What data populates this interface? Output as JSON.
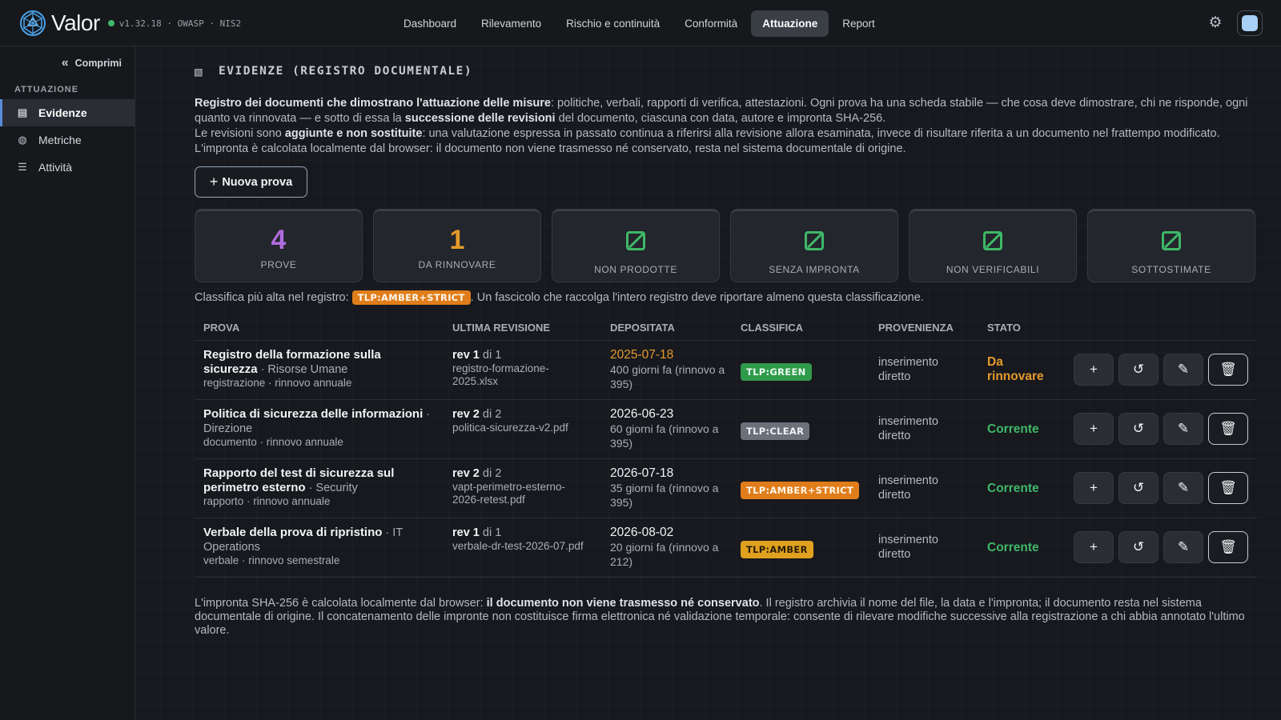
{
  "brand": {
    "name": "Valor",
    "version": "v1.32.18 · OWASP · NIS2",
    "accent": "#3fb868"
  },
  "nav": [
    {
      "label": "Dashboard",
      "active": false
    },
    {
      "label": "Rilevamento",
      "active": false
    },
    {
      "label": "Rischio e continuità",
      "active": false
    },
    {
      "label": "Conformità",
      "active": false
    },
    {
      "label": "Attuazione",
      "active": true
    },
    {
      "label": "Report",
      "active": false
    }
  ],
  "sidebar": {
    "collapse_label": "Comprimi",
    "section": "ATTUAZIONE",
    "items": [
      {
        "label": "Evidenze",
        "icon": "evidence-icon",
        "active": true
      },
      {
        "label": "Metriche",
        "icon": "metrics-icon",
        "active": false
      },
      {
        "label": "Attività",
        "icon": "list-icon",
        "active": false
      }
    ]
  },
  "page": {
    "title": "EVIDENZE (REGISTRO DOCUMENTALE)",
    "intro": {
      "p1_bold": "Registro dei documenti che dimostrano l'attuazione delle misure",
      "p1_a": ": politiche, verbali, rapporti di verifica, attestazioni. Ogni prova ha una scheda stabile — che cosa deve dimostrare, chi ne risponde, ogni quanto va rinnovata — e sotto di essa la ",
      "p1_bold2": "successione delle revisioni",
      "p1_b": " del documento, ciascuna con data, autore e impronta SHA-256.",
      "p2_a": "Le revisioni sono ",
      "p2_bold": "aggiunte e non sostituite",
      "p2_b": ": una valutazione espressa in passato continua a riferirsi alla revisione allora esaminata, invece di risultare riferita a un documento nel frattempo modificato. L'impronta è calcolata localmente dal browser: il documento non viene trasmesso né conservato, resta nel sistema documentale di origine."
    },
    "new_button": "Nuova prova"
  },
  "stats": [
    {
      "value": "4",
      "label": "PROVE",
      "color": "#b06ce0"
    },
    {
      "value": "1",
      "label": "DA RINNOVARE",
      "color": "#e59a2b"
    },
    {
      "value": "0",
      "label": "NON PRODOTTE",
      "color": "#3fb868"
    },
    {
      "value": "0",
      "label": "SENZA IMPRONTA",
      "color": "#3fb868"
    },
    {
      "value": "0",
      "label": "NON VERIFICABILI",
      "color": "#3fb868"
    },
    {
      "value": "0",
      "label": "SOTTOSTIMATE",
      "color": "#3fb868"
    }
  ],
  "classification": {
    "prefix": "Classifica più alta nel registro:",
    "badge": "TLP:AMBER+STRICT",
    "suffix": ". Un fascicolo che raccolga l'intero registro deve riportare almeno questa classificazione."
  },
  "table": {
    "headers": [
      "PROVA",
      "ULTIMA REVISIONE",
      "DEPOSITATA",
      "CLASSIFICA",
      "PROVENIENZA",
      "STATO"
    ],
    "rows": [
      {
        "title": "Registro della formazione sulla sicurezza",
        "owner": " · Risorse Umane",
        "meta": "registrazione · rinnovo annuale",
        "rev": "rev 1",
        "rev_of": " di 1",
        "file": "registro-formazione-2025.xlsx",
        "date": "2025-07-18",
        "ago": "400 giorni fa (rinnovo a 395)",
        "tlp": "TLP:GREEN",
        "origin": "inserimento diretto",
        "status": "Da rinnovare"
      },
      {
        "title": "Politica di sicurezza delle informazioni",
        "owner": " · Direzione",
        "meta": "documento · rinnovo annuale",
        "rev": "rev 2",
        "rev_of": " di 2",
        "file": "politica-sicurezza-v2.pdf",
        "date": "2026-06-23",
        "ago": "60 giorni fa (rinnovo a 395)",
        "tlp": "TLP:CLEAR",
        "origin": "inserimento diretto",
        "status": "Corrente"
      },
      {
        "title": "Rapporto del test di sicurezza sul perimetro esterno",
        "owner": " · Security",
        "meta": "rapporto · rinnovo annuale",
        "rev": "rev 2",
        "rev_of": " di 2",
        "file": "vapt-perimetro-esterno-2026-retest.pdf",
        "date": "2026-07-18",
        "ago": "35 giorni fa (rinnovo a 395)",
        "tlp": "TLP:AMBER+STRICT",
        "origin": "inserimento diretto",
        "status": "Corrente"
      },
      {
        "title": "Verbale della prova di ripristino",
        "owner": " · IT Operations",
        "meta": "verbale · rinnovo semestrale",
        "rev": "rev 1",
        "rev_of": " di 1",
        "file": "verbale-dr-test-2026-07.pdf",
        "date": "2026-08-02",
        "ago": "20 giorni fa (rinnovo a 212)",
        "tlp": "TLP:AMBER",
        "origin": "inserimento diretto",
        "status": "Corrente"
      }
    ]
  },
  "footnote": {
    "a": "L'impronta SHA-256 è calcolata localmente dal browser: ",
    "bold": "il documento non viene trasmesso né conservato",
    "b": ". Il registro archivia il nome del file, la data e l'impronta; il documento resta nel sistema documentale di origine. Il concatenamento delle impronte non costituisce firma elettronica né validazione temporale: consente di rilevare modifiche successive alla registrazione a chi abbia annotato l'ultimo valore."
  }
}
